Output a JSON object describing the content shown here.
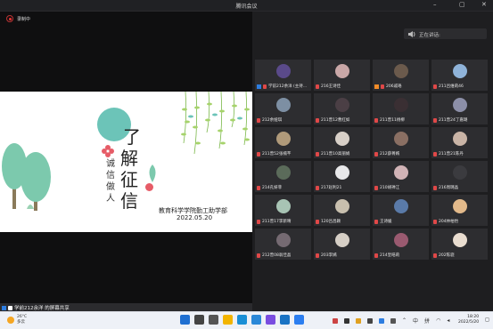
{
  "window": {
    "title": "腾讯会议"
  },
  "recording": {
    "label": "录制中"
  },
  "slide": {
    "title_chars": [
      "了",
      "解",
      "征",
      "信"
    ],
    "subtitle_chars": [
      "诚",
      "信",
      "做",
      "人"
    ],
    "organization": "教育科学学院勤工助学部",
    "date": "2022.05.20"
  },
  "share_bar": {
    "label": "学前212余洋 的屏幕共享"
  },
  "speaking": {
    "label": "正在讲话:"
  },
  "participants": [
    {
      "name": "学前212余洋 (主持...",
      "color": "#5a4a8a",
      "badges": [
        "blue"
      ]
    },
    {
      "name": "216王诗佳",
      "color": "#c9a7a7"
    },
    {
      "name": "206戚珞",
      "color": "#6b5a4c",
      "badges": [
        "orange"
      ]
    },
    {
      "name": "211吕维莉46",
      "color": "#8fb3d9"
    },
    {
      "name": "212余娅琪",
      "color": "#7d8fa3"
    },
    {
      "name": "211曾12曹红如",
      "color": "#4b3f45"
    },
    {
      "name": "211曾11杨柳",
      "color": "#3a2f33"
    },
    {
      "name": "211曾24丁嘉璐",
      "color": "#8c8fa8"
    },
    {
      "name": "211曾52张楠芊",
      "color": "#b09a7a"
    },
    {
      "name": "211曾10高丽娟",
      "color": "#d8d0c8"
    },
    {
      "name": "212薛菁嫣",
      "color": "#8a6f63"
    },
    {
      "name": "211曾21陈丹",
      "color": "#c9b4a6"
    },
    {
      "name": "214孔妍菲",
      "color": "#5b6b5a"
    },
    {
      "name": "217赵利21",
      "color": "#e8e8ea"
    },
    {
      "name": "210胡禅江",
      "color": "#d1b3b6"
    },
    {
      "name": "216周璐晶",
      "color": "#3b3b3f"
    },
    {
      "name": "211曾17李新晴",
      "color": "#a8c4b4"
    },
    {
      "name": "120吕昌颖",
      "color": "#c8bfae"
    },
    {
      "name": "王诗媛",
      "color": "#5a7aa8"
    },
    {
      "name": "204林柏怡",
      "color": "#e2b98a"
    },
    {
      "name": "212曾08翁佳晶",
      "color": "#756a72"
    },
    {
      "name": "203李嫣",
      "color": "#d6cfc6"
    },
    {
      "name": "214皇皓莉",
      "color": "#9a5a70"
    },
    {
      "name": "202陈骁",
      "color": "#e9ddd0"
    }
  ],
  "weather": {
    "temp": "26°C",
    "desc": "多云"
  },
  "taskbar_icons": [
    {
      "name": "windows-icon",
      "color": "#1f6fd1"
    },
    {
      "name": "search-icon",
      "color": "#444"
    },
    {
      "name": "task-view-icon",
      "color": "#555"
    },
    {
      "name": "file-explorer-icon",
      "color": "#f2b400"
    },
    {
      "name": "edge-icon",
      "color": "#1a8fd6"
    },
    {
      "name": "photos-icon",
      "color": "#2b88d8"
    },
    {
      "name": "app-icon",
      "color": "#7a4de0"
    },
    {
      "name": "store-icon",
      "color": "#1a73c4"
    },
    {
      "name": "meeting-icon",
      "color": "#2c7ef0"
    }
  ],
  "tray": {
    "ime": "中",
    "ime2": "拼"
  },
  "clock": {
    "time": "18:20",
    "date": "2022/5/20"
  }
}
